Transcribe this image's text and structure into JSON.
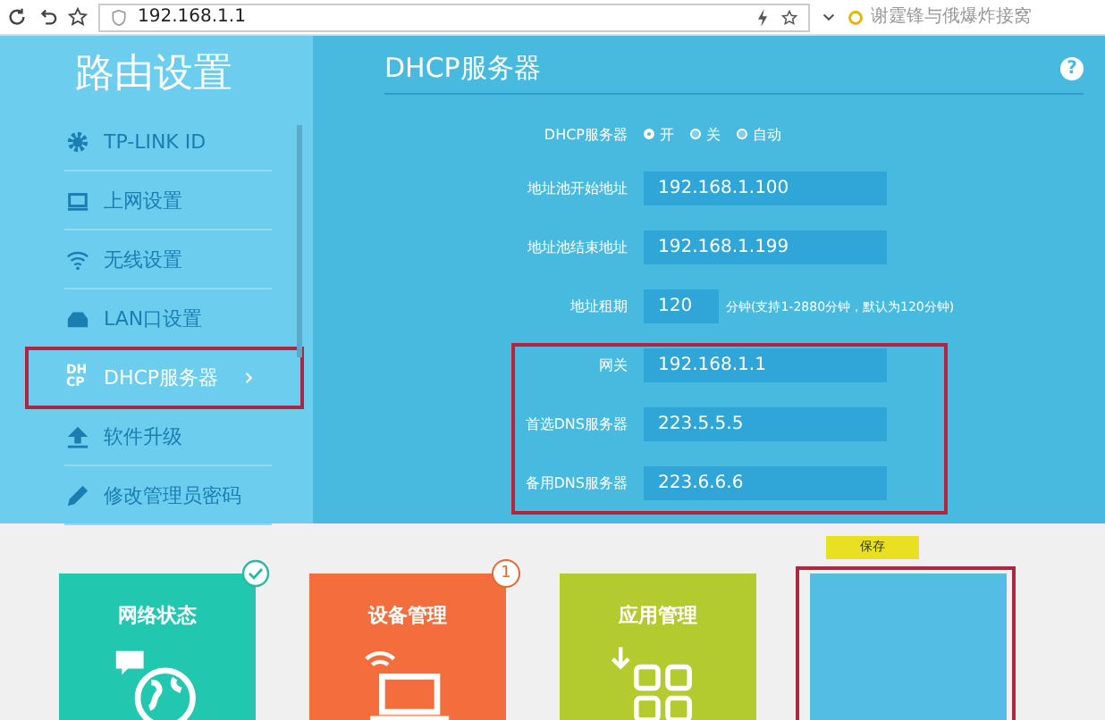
{
  "browser": {
    "url": "192.168.1.1",
    "search": {
      "placeholder": "谢霆锋与俄爆炸接窝"
    }
  },
  "sidebar": {
    "title": "路由设置",
    "items": [
      {
        "label": "TP-LINK ID",
        "selected": false,
        "highlighted": false
      },
      {
        "label": "上网设置",
        "selected": false,
        "highlighted": false
      },
      {
        "label": "无线设置",
        "selected": false,
        "highlighted": false
      },
      {
        "label": "LAN口设置",
        "selected": false,
        "highlighted": false
      },
      {
        "label": "DHCP服务器",
        "icon_text": "DHCP",
        "selected": true,
        "highlighted": true
      },
      {
        "label": "软件升级",
        "selected": false,
        "highlighted": false
      },
      {
        "label": "修改管理员密码",
        "selected": false,
        "highlighted": false
      }
    ]
  },
  "panel": {
    "title": "DHCP服务器",
    "help": "?",
    "groups": [
      {
        "highlighted": false,
        "rows": [
          {
            "kind": "radio",
            "label": "DHCP服务器",
            "options": [
              {
                "label": "开",
                "selected": true
              },
              {
                "label": "关",
                "selected": false
              },
              {
                "label": "自动",
                "selected": false
              }
            ]
          },
          {
            "kind": "input",
            "label": "地址池开始地址",
            "value": "192.168.1.100"
          },
          {
            "kind": "input",
            "label": "地址池结束地址",
            "value": "192.168.1.199"
          },
          {
            "kind": "short-input",
            "label": "地址租期",
            "value": "120",
            "note": "分钟(支持1-2880分钟，默认为120分钟)"
          }
        ]
      },
      {
        "highlighted": true,
        "rows": [
          {
            "kind": "input",
            "label": "网关",
            "value": "192.168.1.1"
          },
          {
            "kind": "input",
            "label": "首选DNS服务器",
            "value": "223.5.5.5"
          },
          {
            "kind": "input",
            "label": "备用DNS服务器",
            "value": "223.6.6.6"
          }
        ]
      }
    ]
  },
  "save_button": "保存",
  "tiles": [
    {
      "title": "网络状态",
      "color": "#22c7b0",
      "badge": {
        "kind": "check"
      },
      "highlighted": false
    },
    {
      "title": "设备管理",
      "color": "#f36d3d",
      "badge": {
        "kind": "count",
        "text": "1"
      },
      "highlighted": false
    },
    {
      "title": "应用管理",
      "color": "#b3cb2f",
      "highlighted": false
    },
    {
      "color": "#53bde3",
      "highlighted": true
    }
  ]
}
